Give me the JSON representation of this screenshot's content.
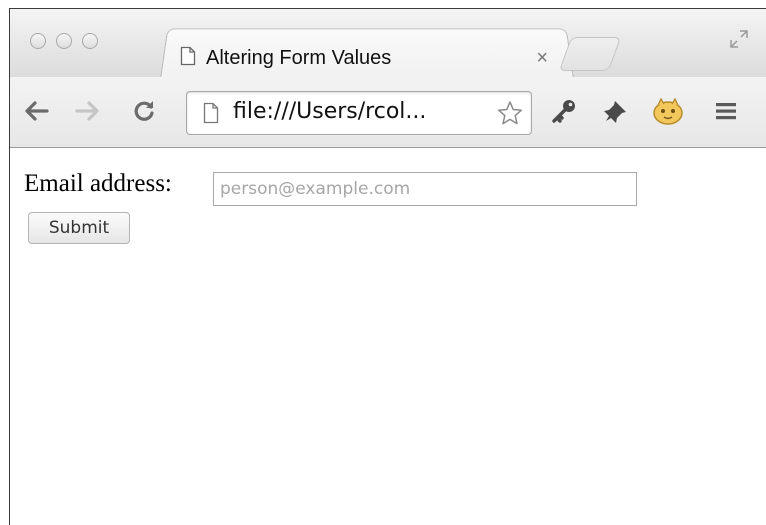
{
  "browser": {
    "tab": {
      "title": "Altering Form Values",
      "close_glyph": "×",
      "icon": "document-icon"
    },
    "address_bar": {
      "url": "file:///Users/rcol..."
    },
    "toolbar_icons": [
      "back-icon",
      "forward-icon",
      "reload-icon",
      "star-icon",
      "key-icon",
      "pin-icon",
      "extension-icon",
      "menu-icon"
    ]
  },
  "page": {
    "email_label": "Email address:",
    "email_placeholder": "person@example.com",
    "email_value": "",
    "submit_label": "Submit"
  }
}
